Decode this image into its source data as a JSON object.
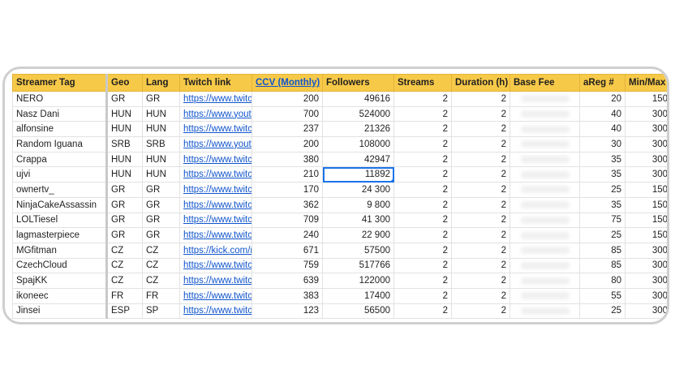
{
  "headers": [
    "Streamer Tag",
    "Geo",
    "Lang",
    "Twitch link",
    "CCV (Monthly)",
    "Followers",
    "Streams",
    "Duration (h)",
    "Base Fee",
    "aReg #",
    "Min/Max"
  ],
  "rows": [
    {
      "tag": "NERO",
      "geo": "GR",
      "lang": "GR",
      "link": "https://www.twitc",
      "ccv": "200",
      "followers": "49616",
      "streams": "2",
      "duration": "2",
      "areg": "20",
      "minmax": "150"
    },
    {
      "tag": "Nasz Dani",
      "geo": "HUN",
      "lang": "HUN",
      "link": "https://www.yout",
      "ccv": "700",
      "followers": "524000",
      "streams": "2",
      "duration": "2",
      "areg": "40",
      "minmax": "300"
    },
    {
      "tag": "alfonsine",
      "geo": "HUN",
      "lang": "HUN",
      "link": "https://www.twitc",
      "ccv": "237",
      "followers": "21326",
      "streams": "2",
      "duration": "2",
      "areg": "40",
      "minmax": "300"
    },
    {
      "tag": "Random Iguana",
      "geo": "SRB",
      "lang": "SRB",
      "link": "https://www.yout",
      "ccv": "200",
      "followers": "108000",
      "streams": "2",
      "duration": "2",
      "areg": "30",
      "minmax": "300"
    },
    {
      "tag": "Crappa",
      "geo": "HUN",
      "lang": "HUN",
      "link": "https://www.twitc",
      "ccv": "380",
      "followers": "42947",
      "streams": "2",
      "duration": "2",
      "areg": "35",
      "minmax": "300"
    },
    {
      "tag": "ujvi",
      "geo": "HUN",
      "lang": "HUN",
      "link": "https://www.twitc",
      "ccv": "210",
      "followers": "11892",
      "streams": "2",
      "duration": "2",
      "areg": "35",
      "minmax": "300"
    },
    {
      "tag": "ownertv_",
      "geo": "GR",
      "lang": "GR",
      "link": "https://www.twitc",
      "ccv": "170",
      "followers": "24 300",
      "streams": "2",
      "duration": "2",
      "areg": "25",
      "minmax": "150"
    },
    {
      "tag": "NinjaCakeAssassin",
      "geo": "GR",
      "lang": "GR",
      "link": "https://www.twitc",
      "ccv": "362",
      "followers": "9 800",
      "streams": "2",
      "duration": "2",
      "areg": "35",
      "minmax": "150"
    },
    {
      "tag": "LOLTiesel",
      "geo": "GR",
      "lang": "GR",
      "link": "https://www.twitc",
      "ccv": "709",
      "followers": "41 300",
      "streams": "2",
      "duration": "2",
      "areg": "75",
      "minmax": "150"
    },
    {
      "tag": "lagmasterpiece",
      "geo": "GR",
      "lang": "GR",
      "link": "https://www.twitc",
      "ccv": "240",
      "followers": "22 900",
      "streams": "2",
      "duration": "2",
      "areg": "25",
      "minmax": "150"
    },
    {
      "tag": "MGfitman",
      "geo": "CZ",
      "lang": "CZ",
      "link": "https://kick.com/r",
      "ccv": "671",
      "followers": "57500",
      "streams": "2",
      "duration": "2",
      "areg": "85",
      "minmax": "300"
    },
    {
      "tag": "CzechCloud",
      "geo": "CZ",
      "lang": "CZ",
      "link": "https://www.twitc",
      "ccv": "759",
      "followers": "517766",
      "streams": "2",
      "duration": "2",
      "areg": "85",
      "minmax": "300"
    },
    {
      "tag": "SpajKK",
      "geo": "CZ",
      "lang": "CZ",
      "link": "https://www.twitc",
      "ccv": "639",
      "followers": "122000",
      "streams": "2",
      "duration": "2",
      "areg": "80",
      "minmax": "300"
    },
    {
      "tag": "ikoneec",
      "geo": "FR",
      "lang": "FR",
      "link": "https://www.twitc",
      "ccv": "383",
      "followers": "17400",
      "streams": "2",
      "duration": "2",
      "areg": "55",
      "minmax": "300"
    },
    {
      "tag": "Jinsei",
      "geo": "ESP",
      "lang": "SP",
      "link": "https://www.twitc",
      "ccv": "123",
      "followers": "56500",
      "streams": "2",
      "duration": "2",
      "areg": "25",
      "minmax": "300"
    }
  ],
  "colors": {
    "header_bg": "#f7c948",
    "link": "#1155cc",
    "selection": "#1a73e8"
  }
}
